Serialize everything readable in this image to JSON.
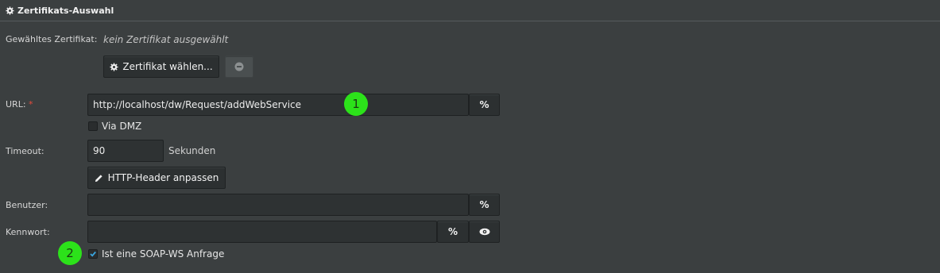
{
  "section": {
    "title": "Zertifikats-Auswahl"
  },
  "certificate": {
    "label": "Gewähltes Zertifikat:",
    "value": "kein Zertifikat ausgewählt",
    "choose_button": "Zertifikat wählen...",
    "remove_icon": "minus-circle-icon"
  },
  "url": {
    "label": "URL:",
    "required_mark": "*",
    "value": "http://localhost/dw/Request/addWebService",
    "placeholder_button": "%"
  },
  "via_dmz": {
    "label": "Via DMZ",
    "checked": false
  },
  "timeout": {
    "label": "Timeout:",
    "value": "90",
    "unit": "Sekunden"
  },
  "http_header_button": "HTTP-Header anpassen",
  "user": {
    "label": "Benutzer:",
    "value": "",
    "placeholder_button": "%"
  },
  "password": {
    "label": "Kennwort:",
    "value": "",
    "placeholder_button": "%",
    "reveal_icon": "eye-icon"
  },
  "soap": {
    "label": "Ist eine SOAP-WS Anfrage",
    "checked": true
  },
  "annotations": {
    "badge1": "1",
    "badge2": "2",
    "color": "#2ce21a"
  }
}
